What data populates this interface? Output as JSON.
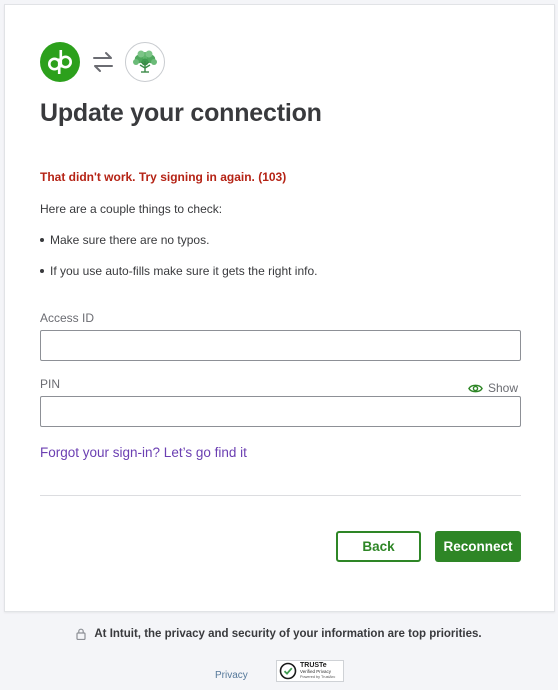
{
  "logos": {
    "app_icon": "quickbooks-icon",
    "swap_icon": "swap-arrows-icon",
    "bank_icon": "tree-icon"
  },
  "heading": "Update your connection",
  "error_message": "That didn't work. Try signing in again. (103)",
  "intro": "Here are a couple things to check:",
  "tips": [
    "Make sure there are no typos.",
    "If you use auto-fills make sure it gets the right info."
  ],
  "form": {
    "access_id_label": "Access ID",
    "access_id_value": "",
    "pin_label": "PIN",
    "pin_value": "",
    "show_label": "Show"
  },
  "forgot_link": "Forgot your sign-in? Let’s go find it",
  "buttons": {
    "back": "Back",
    "reconnect": "Reconnect"
  },
  "footer": {
    "privacy_note": "At Intuit, the privacy and security of your information are top priorities.",
    "privacy_link": "Privacy",
    "truste_line1": "TRUSTe",
    "truste_line2": "Verified Privacy",
    "truste_line3": "Powered by TrustArc"
  },
  "colors": {
    "brand_green": "#2ca01c",
    "button_green": "#2e8626",
    "error_red": "#b52315",
    "link_purple": "#6b3fb2"
  }
}
